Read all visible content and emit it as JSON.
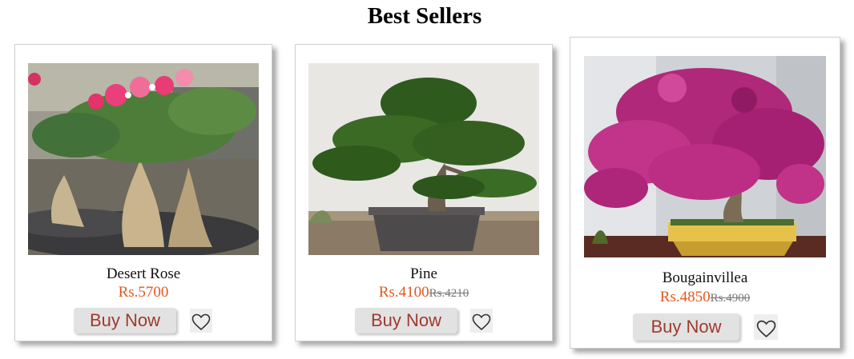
{
  "section": {
    "title": "Best Sellers"
  },
  "products": [
    {
      "name": "Desert Rose",
      "price": "Rs.5700",
      "old_price": "",
      "buy_label": "Buy Now"
    },
    {
      "name": "Pine",
      "price": "Rs.4100",
      "old_price": "Rs.4210",
      "buy_label": "Buy Now"
    },
    {
      "name": "Bougainvillea",
      "price": "Rs.4850",
      "old_price": "Rs.4900",
      "buy_label": "Buy Now"
    }
  ],
  "colors": {
    "price": "#e2571e",
    "buy_text": "#a03a2d",
    "buy_bg": "#e2e2e2"
  },
  "icons": {
    "wishlist": "heart-icon"
  }
}
